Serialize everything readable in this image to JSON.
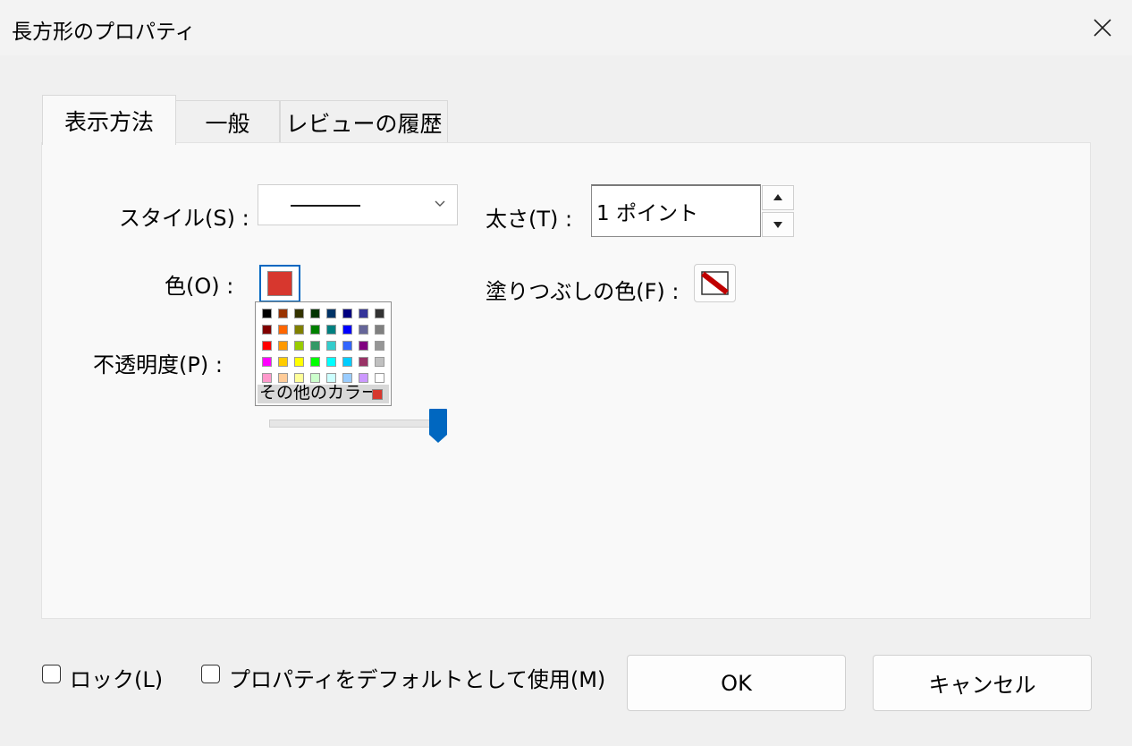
{
  "window": {
    "title": "長方形のプロパティ",
    "close_icon": "close-icon"
  },
  "tabs": [
    {
      "label": "表示方法",
      "active": true
    },
    {
      "label": "一般",
      "active": false
    },
    {
      "label": "レビューの履歴",
      "active": false
    }
  ],
  "appearance": {
    "style_label": "スタイル(S) :",
    "style_value": "solid-line",
    "thickness_label": "太さ(T) :",
    "thickness_value": "1 ポイント",
    "color_label": "色(O) :",
    "color_value": "#d7372e",
    "fill_label": "塗りつぶしの色(F) :",
    "fill_value": "none",
    "opacity_label": "不透明度(P) :",
    "opacity_value": 1.0
  },
  "palette": {
    "colors": [
      [
        "#000000",
        "#993300",
        "#333300",
        "#003300",
        "#003366",
        "#000080",
        "#333399",
        "#333333"
      ],
      [
        "#800000",
        "#ff6600",
        "#808000",
        "#008000",
        "#008080",
        "#0000ff",
        "#666699",
        "#808080"
      ],
      [
        "#ff0000",
        "#ff9900",
        "#99cc00",
        "#339966",
        "#33cccc",
        "#3366ff",
        "#800080",
        "#969696"
      ],
      [
        "#ff00ff",
        "#ffcc00",
        "#ffff00",
        "#00ff00",
        "#00ffff",
        "#00ccff",
        "#993366",
        "#c0c0c0"
      ],
      [
        "#ff99cc",
        "#ffcc99",
        "#ffff99",
        "#ccffcc",
        "#ccffff",
        "#99ccff",
        "#cc99ff",
        "#ffffff"
      ]
    ],
    "more_label": "その他のカラー"
  },
  "footer": {
    "lock_label": "ロック(L)",
    "lock_checked": false,
    "default_label": "プロパティをデフォルトとして使用(M)",
    "default_checked": false,
    "ok_label": "OK",
    "cancel_label": "キャンセル"
  },
  "colors": {
    "accent": "#0067c0",
    "fill_stroke": "#c00000"
  }
}
